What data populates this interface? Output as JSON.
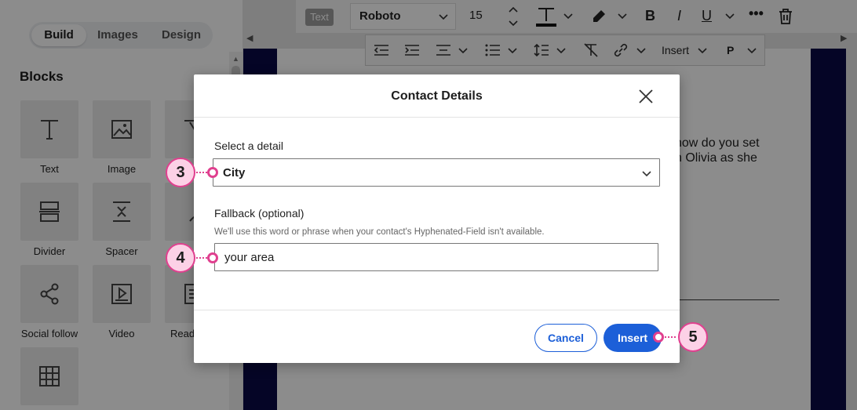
{
  "sidebar": {
    "tabs": [
      {
        "label": "Build",
        "active": true
      },
      {
        "label": "Images",
        "active": false
      },
      {
        "label": "Design",
        "active": false
      }
    ],
    "blocks_title": "Blocks",
    "blocks": [
      {
        "label": "Text",
        "icon": "text-icon"
      },
      {
        "label": "Image",
        "icon": "image-icon"
      },
      {
        "label": "",
        "icon": "button-icon"
      },
      {
        "label": "Divider",
        "icon": "divider-icon"
      },
      {
        "label": "Spacer",
        "icon": "spacer-icon"
      },
      {
        "label": "",
        "icon": "user-icon"
      },
      {
        "label": "Social follow",
        "icon": "social-follow-icon"
      },
      {
        "label": "Video",
        "icon": "video-icon"
      },
      {
        "label": "Read",
        "icon": "read-more-icon"
      },
      {
        "label": "",
        "icon": "table-icon"
      }
    ]
  },
  "toolbar": {
    "text_badge": "Text",
    "font": "Roboto",
    "font_size": "15",
    "insert_label": "Insert",
    "paragraph_label": "P"
  },
  "email_preview": {
    "text": "how do you set\nn Olivia as she"
  },
  "modal": {
    "title": "Contact Details",
    "select_label": "Select a detail",
    "select_value": "City",
    "fallback_label": "Fallback (optional)",
    "fallback_helper": "We'll use this word or phrase when your contact's Hyphenated-Field isn't available.",
    "fallback_value": "your area",
    "cancel_label": "Cancel",
    "insert_label": "Insert"
  },
  "callouts": [
    "3",
    "4",
    "5"
  ],
  "colors": {
    "accent": "#1c5fd8",
    "callout_fill": "#fcd1e6",
    "callout_border": "#e0408f",
    "navy": "#0a0a46"
  }
}
